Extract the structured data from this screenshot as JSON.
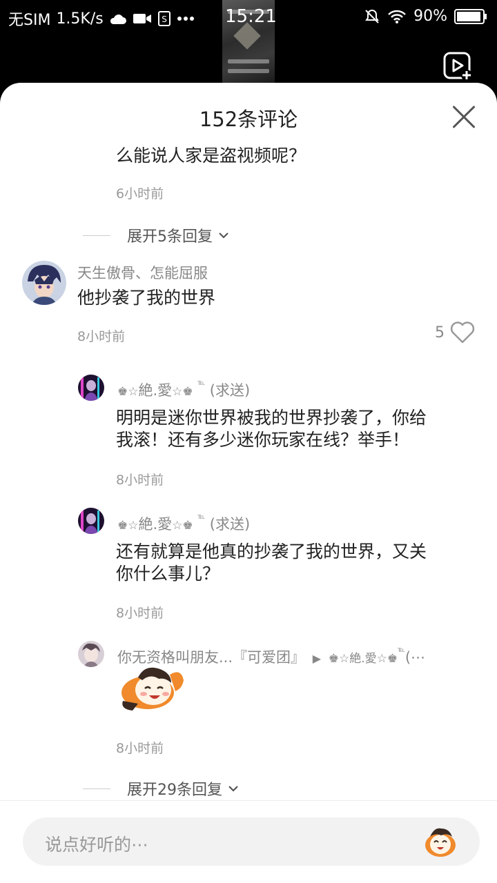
{
  "status_bar": {
    "carrier": "无SIM",
    "speed": "1.5K/s",
    "time": "15:21",
    "battery": "90%",
    "icons": [
      "cloud-icon",
      "video-icon",
      "sim-icon",
      "more-dots-icon",
      "mute-bell-icon",
      "wifi-icon",
      "battery-icon"
    ]
  },
  "sheet": {
    "title": "152条评论"
  },
  "top_reply": {
    "text": "么能说人家是盗视频呢？",
    "time": "6小时前"
  },
  "expand_1": "展开5条回复",
  "comment": {
    "user": "天生傲骨、怎能屈服",
    "text": "他抄袭了我的世界",
    "time": "8小时前",
    "likes": "5"
  },
  "replies": [
    {
      "user_sym_left": "♚☆",
      "user_main": "絶.愛",
      "user_sym_right": "☆♚",
      "user_tel": "℡",
      "user_suffix": "(求送)",
      "line1": "明明是迷你世界被我的世界抄袭了，你给",
      "line2": "我滚！还有多少迷你玩家在线？举手！",
      "time": "8小时前"
    },
    {
      "user_sym_left": "♚☆",
      "user_main": "絶.愛",
      "user_sym_right": "☆♚",
      "user_tel": "℡",
      "user_suffix": "(求送)",
      "line1": "还有就算是他真的抄袭了我的世界，又关",
      "line2": "你什么事儿？",
      "time": "8小时前"
    },
    {
      "user": "你无资格叫朋友...『可爱团』",
      "arrow": "▶",
      "reply_to": "♚☆絶.愛☆♚",
      "reply_to_tel": "℡",
      "reply_to_suffix": "(⋯",
      "time": "8小时前"
    }
  ],
  "expand_2": "展开29条回复",
  "input": {
    "placeholder": "说点好听的⋯"
  },
  "colors": {
    "text": "#222222",
    "muted": "#999999",
    "input_bg": "#f2f2f2"
  }
}
